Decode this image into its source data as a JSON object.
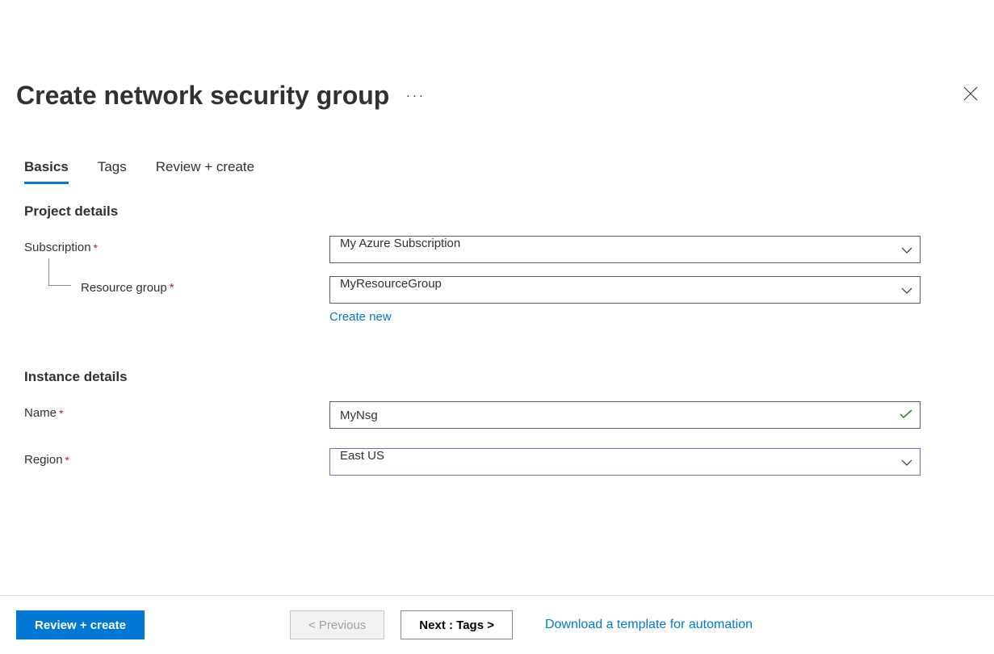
{
  "header": {
    "title": "Create network security group"
  },
  "tabs": {
    "basics": "Basics",
    "tags": "Tags",
    "review": "Review + create"
  },
  "sections": {
    "project": {
      "title": "Project details",
      "subscription_label": "Subscription",
      "subscription_value": "My Azure Subscription",
      "resource_group_label": "Resource group",
      "resource_group_value": "MyResourceGroup",
      "create_new_link": "Create new"
    },
    "instance": {
      "title": "Instance details",
      "name_label": "Name",
      "name_value": "MyNsg",
      "region_label": "Region",
      "region_value": "East US"
    }
  },
  "footer": {
    "review_create": "Review + create",
    "previous": "< Previous",
    "next": "Next : Tags >",
    "download_template": "Download a template for automation"
  }
}
